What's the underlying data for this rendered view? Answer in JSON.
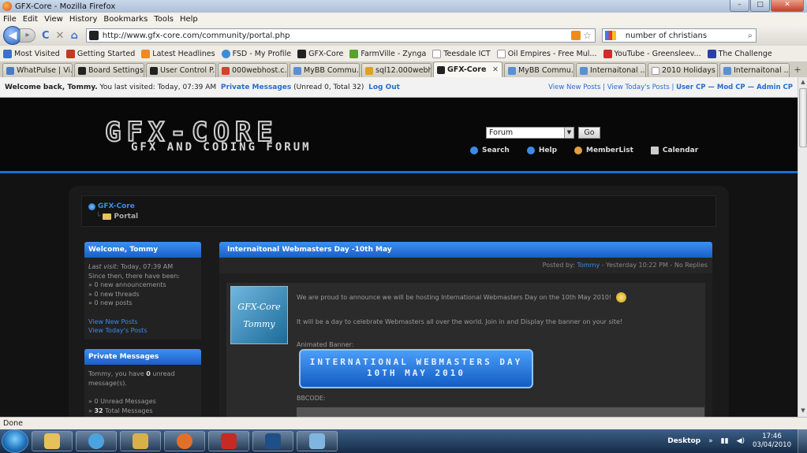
{
  "window": {
    "title": "GFX-Core - Mozilla Firefox",
    "minimize": "–",
    "maximize": "□",
    "close": "✕"
  },
  "menu": [
    "File",
    "Edit",
    "View",
    "History",
    "Bookmarks",
    "Tools",
    "Help"
  ],
  "nav": {
    "url": "http://www.gfx-core.com/community/portal.php",
    "search_value": "number of christians",
    "back_glyph": "◀",
    "forward_glyph": "▸",
    "reload_glyph": "C",
    "stop_glyph": "✕",
    "home_glyph": "⌂"
  },
  "bookmarks": [
    {
      "label": "Most Visited",
      "color": "#3b6fcf"
    },
    {
      "label": "Getting Started",
      "color": "#c23a1f"
    },
    {
      "label": "Latest Headlines",
      "color": "#f28a1a"
    },
    {
      "label": "FSD - My Profile",
      "color": "#3b8cd6"
    },
    {
      "label": "GFX-Core",
      "color": "#222222"
    },
    {
      "label": "FarmVille - Zynga",
      "color": "#5aa130"
    },
    {
      "label": "Teesdale ICT",
      "color": "#cccccc"
    },
    {
      "label": "Oil Empires - Free Mul...",
      "color": "#cccccc"
    },
    {
      "label": "YouTube - Greensleev...",
      "color": "#d32a2a"
    },
    {
      "label": "The Challenge",
      "color": "#2a3ea8"
    }
  ],
  "tabs": [
    {
      "label": "WhatPulse | Vi...",
      "color": "#4a7bc8",
      "active": false
    },
    {
      "label": "Board Settings...",
      "color": "#222222",
      "active": false
    },
    {
      "label": "User Control P...",
      "color": "#222222",
      "active": false
    },
    {
      "label": "000webhost.c...",
      "color": "#d8402a",
      "active": false
    },
    {
      "label": "MyBB Commu...",
      "color": "#5a8fd8",
      "active": false
    },
    {
      "label": "sql12.000webh...",
      "color": "#e0a020",
      "active": false
    },
    {
      "label": "GFX-Core",
      "color": "#222222",
      "active": true
    },
    {
      "label": "MyBB Commu...",
      "color": "#5a8fd8",
      "active": false
    },
    {
      "label": "Internaitonal ...",
      "color": "#5a8fd8",
      "active": false
    },
    {
      "label": "2010 Holidays ...",
      "color": "#cccccc",
      "active": false
    },
    {
      "label": "Internaitonal ...",
      "color": "#5a8fd8",
      "active": false
    }
  ],
  "welcome": {
    "greeting": "Welcome back, Tommy.",
    "last_visit": "You last visited: Today, 07:39 AM",
    "pm_link": "Private Messages",
    "pm_counts": "(Unread 0, Total 32)",
    "logout": "Log Out",
    "right_links": "View New Posts | View Today's Posts |",
    "cp_links": "User CP — Mod CP — Admin CP"
  },
  "header": {
    "logo_main": "GFX-CORE",
    "logo_sub": "GFX AND CODING FORUM",
    "forum_select": "Forum",
    "go_label": "Go",
    "nav": [
      {
        "label": "Search",
        "color": "#3d8be8"
      },
      {
        "label": "Help",
        "color": "#3d8be8"
      },
      {
        "label": "MemberList",
        "color": "#e0a040"
      },
      {
        "label": "Calendar",
        "color": "#cccccc"
      }
    ]
  },
  "breadcrumb": {
    "root": "GFX-Core",
    "current": "Portal"
  },
  "welcome_box": {
    "title": "Welcome, Tommy",
    "last_visit_label": "Last visit:",
    "last_visit_value": "Today, 07:39 AM",
    "since": "Since then, there have been:",
    "stats": [
      "» 0 new announcements",
      "» 0 new threads",
      "» 0 new posts"
    ],
    "links": [
      "View New Posts",
      "View Today's Posts"
    ]
  },
  "pm_box": {
    "title": "Private Messages",
    "line1": "Tommy, you have",
    "unread_count": "0",
    "line1_end": "unread",
    "line2": "message(s).",
    "unread_line": "» 0 Unread Messages",
    "total_count": "32",
    "total_label": "Total Messages",
    "total_prefix": "»"
  },
  "announcement": {
    "title": "Internaitonal Webmasters Day -10th May",
    "posted_by_label": "Posted by:",
    "author": "Tommy",
    "meta": "- Yesterday 10:22 PM - No Replies",
    "avatar_line1": "GFX-Core",
    "avatar_line2": "Tommy",
    "p1": "We are proud to announce we will be hosting International Webmasters Day on the 10th May 2010!",
    "p2": "It will be a day to celebrate Webmasters all over the world. Join in and Display the banner on your site!",
    "p3": "Animated Banner:",
    "banner_line1": "INTERNATIONAL WEBMASTERS DAY",
    "banner_line2": "10TH MAY 2010",
    "bbcode_label": "BBCODE:"
  },
  "status": "Done",
  "taskbar": {
    "apps": [
      {
        "name": "explorer",
        "color": "#e6c15a"
      },
      {
        "name": "media-player",
        "color": "#4aa3e0"
      },
      {
        "name": "folder",
        "color": "#d8b04a"
      },
      {
        "name": "firefox",
        "color": "#e2702a"
      },
      {
        "name": "filezilla",
        "color": "#c62a22"
      },
      {
        "name": "photoshop",
        "color": "#1f4f88"
      },
      {
        "name": "notepad",
        "color": "#7fb6e0"
      }
    ],
    "desktop_label": "Desktop",
    "tray_glyph": "»",
    "time": "17:46",
    "date": "03/04/2010"
  }
}
